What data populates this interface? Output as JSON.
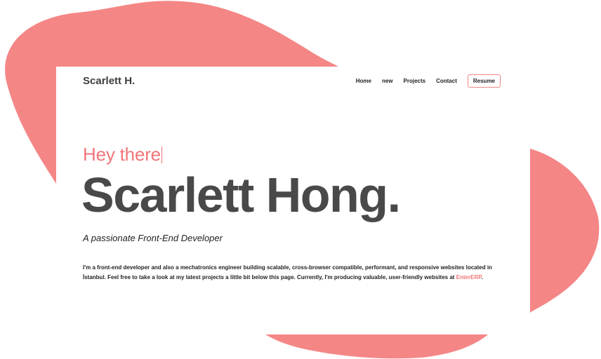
{
  "brand": {
    "name": "Scarlett H."
  },
  "nav": {
    "items": [
      {
        "label": "Home"
      },
      {
        "label": "new"
      },
      {
        "label": "Projects"
      },
      {
        "label": "Contact"
      }
    ],
    "resume_label": "Resume"
  },
  "hero": {
    "greeting": "Hey there",
    "name": "Scarlett Hong.",
    "tagline": "A passionate Front-End Developer",
    "bio_text": "I'm a front-end developer and also a mechatronics engineer building scalable, cross-browser compatible, performant, and responsive websites located in İstanbul. Feel free to take a look at my latest projects a little bit below this page. Currently, I'm producing valuable, user-friendly websites at ",
    "bio_link": "EnterERP",
    "bio_end": "."
  },
  "colors": {
    "accent": "#f07579",
    "blob": "#f58686",
    "heading": "#494949"
  }
}
